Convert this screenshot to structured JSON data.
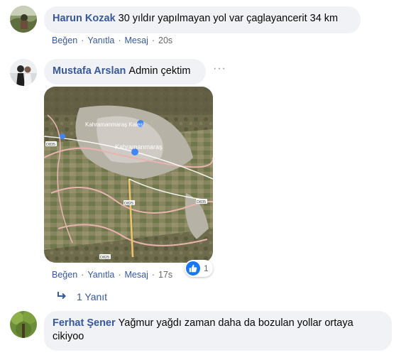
{
  "comments": [
    {
      "author": "Harun Kozak",
      "text": "30 yıldır yapılmayan yol var çaglayancerit 34 km",
      "actions": {
        "like": "Beğen",
        "reply": "Yanıtla",
        "message": "Mesaj",
        "time": "20s"
      }
    },
    {
      "author": "Mustafa Arslan",
      "text": "Admin çektim",
      "more": "···",
      "map_labels": {
        "castle": "Kahramanmaraş Kalesi",
        "city": "Kahramanmaraş",
        "roads": [
          "D835",
          "D825",
          "D825",
          "D835"
        ]
      },
      "actions": {
        "like": "Beğen",
        "reply": "Yanıtla",
        "message": "Mesaj",
        "time": "17s"
      },
      "reaction_count": "1",
      "replies_label": "1 Yanıt"
    },
    {
      "author": "Ferhat Şener",
      "text": "Yağmur yağdı zaman daha da bozulan yollar ortaya cikiyoo"
    }
  ],
  "colors": {
    "link": "#385898",
    "bubble": "#f0f2f5",
    "meta": "#65676b",
    "like_blue": "#1877f2"
  },
  "icons": [
    "reply-arrow-icon",
    "like-reaction-icon",
    "more-options-icon"
  ]
}
